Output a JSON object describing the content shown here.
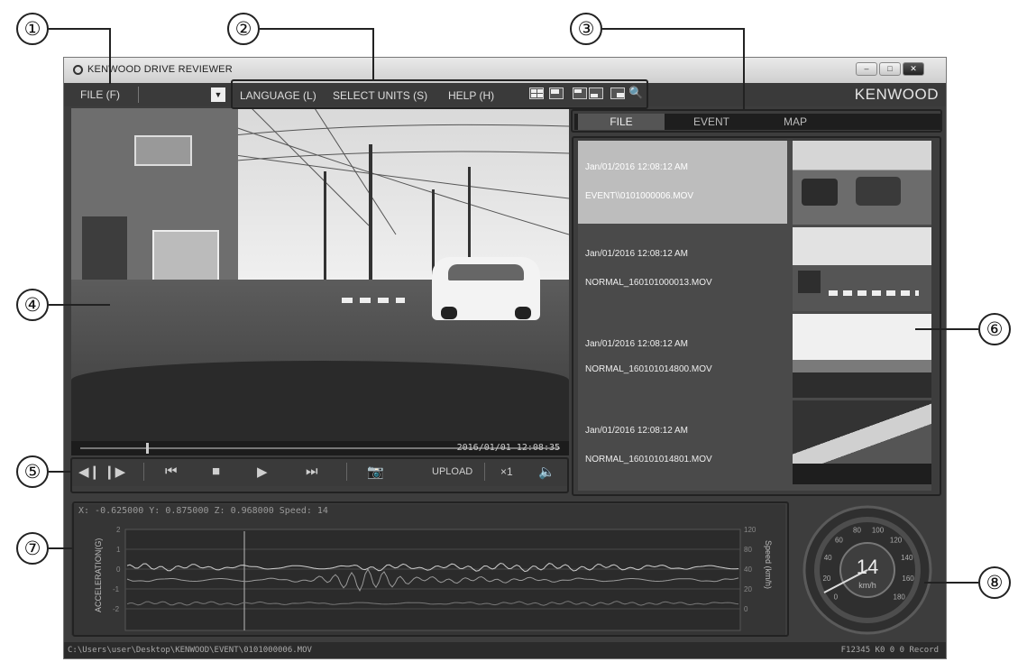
{
  "window": {
    "title": "KENWOOD DRIVE REVIEWER",
    "brand": "KENWOOD"
  },
  "menu": {
    "file": "FILE (F)",
    "language": "LANGUAGE (L)",
    "select_units": "SELECT UNITS (S)",
    "help": "HELP (H)"
  },
  "tabs": [
    {
      "label": "FILE",
      "active": true
    },
    {
      "label": "EVENT",
      "active": false
    },
    {
      "label": "MAP",
      "active": false
    }
  ],
  "video": {
    "timestamp": "2016/01/01 12:08:35"
  },
  "controls": {
    "upload_label": "UPLOAD",
    "speed_label": "×1"
  },
  "files": [
    {
      "date": "Jan/01/2016 12:08:12 AM",
      "name": "EVENT\\\\0101000006.MOV",
      "selected": true
    },
    {
      "date": "Jan/01/2016 12:08:12 AM",
      "name": "NORMAL_160101000013.MOV",
      "selected": false
    },
    {
      "date": "Jan/01/2016 12:08:12 AM",
      "name": "NORMAL_160101014800.MOV",
      "selected": false
    },
    {
      "date": "Jan/01/2016 12:08:12 AM",
      "name": "NORMAL_160101014801.MOV",
      "selected": false
    }
  ],
  "graph": {
    "readout": "X: -0.625000   Y: 0.875000   Z: 0.968000   Speed: 14",
    "left_label": "ACCELERATION(G)",
    "right_label": "Speed (km/h)",
    "left_ticks": [
      "2",
      "1",
      "0",
      "-1",
      "-2"
    ],
    "right_ticks": [
      "120",
      "80",
      "40",
      "20",
      "0"
    ]
  },
  "speedometer": {
    "value": "14",
    "unit": "km/h",
    "ticks": [
      "0",
      "20",
      "40",
      "60",
      "80",
      "100",
      "120",
      "140",
      "160",
      "180"
    ]
  },
  "status": {
    "path": "C:\\Users\\user\\Desktop\\KENWOOD\\EVENT\\0101000006.MOV",
    "right": "F12345 K0 0 0 Record"
  },
  "callouts": [
    "①",
    "②",
    "③",
    "④",
    "⑤",
    "⑥",
    "⑦",
    "⑧"
  ],
  "colors": {
    "window_bg": "#3d3d3d",
    "selected_item": "#bdbdbd",
    "text_light": "#eeeeee"
  }
}
